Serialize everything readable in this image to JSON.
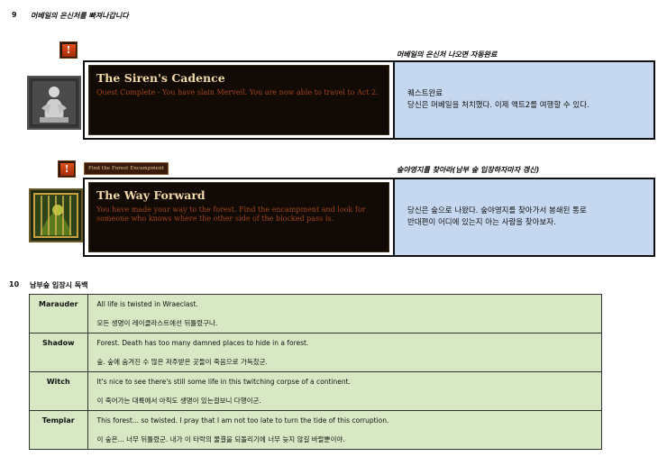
{
  "step9": {
    "number": "9",
    "title": "머베일의 은신처를 빠져나갑니다",
    "quest1": {
      "note": "머베일의 은신처 나오면 자동완료",
      "icon": "siren-statue-icon",
      "name": "The Siren's Cadence",
      "description": "Quest Complete - You have slain Merveil. You are now able to travel to Act 2.",
      "translation_lines": [
        "퀘스트완료",
        "당신은 머베일을 처치했다. 이제 액트2를 여행할 수 있다."
      ]
    },
    "quest2": {
      "banner": "Find the Forest Encampment",
      "note": "숲야영지를 찾아라(남부 숲 입장하자마자 갱신)",
      "icon": "caged-forest-icon",
      "name": "The Way Forward",
      "description": "You have made your way to the forest. Find the encampment and look for someone who knows where the other side of the blocked pass is.",
      "translation_lines": [
        "당신은 숲으로 나왔다. 숲야영지를 찾아가서 봉쇄된 통로",
        "반대편이 어디에 있는지 아는 사람을 찾아보자."
      ]
    }
  },
  "step10": {
    "number": "10",
    "title": "남부숲 입장시 독백",
    "rows": [
      {
        "class_name": "Marauder",
        "en": "All life is twisted in Wraeclast.",
        "ko": "모든 생명이 레이클라스트에선 뒤틀렸구나."
      },
      {
        "class_name": "Shadow",
        "en": "Forest. Death has too many damned places to hide in a forest.",
        "ko": "숲. 숲에 숨겨진 수 많은 저주받은 곳들이 죽음으로 가득찼군."
      },
      {
        "class_name": "Witch",
        "en": "It's nice to see there's still some life in this twitching corpse of a continent.",
        "ko": "이 죽어가는 대륙에서 아직도 생명이 있는걸보니 다행이군."
      },
      {
        "class_name": "Templar",
        "en": "This forest... so twisted. I pray that I am not too late to turn the tide of this corruption.",
        "ko": "이 숲은... 너무 뒤틀렸군. 내가 이 타락의 물결을 되돌리기에 너무 늦지 않길 바랄뿐이야."
      }
    ]
  },
  "colors": {
    "translation_bg": "#c6d8f0",
    "table_bg": "#d8e8c4",
    "quest_bg": "#120a05",
    "quest_title": "#f0d8a8",
    "quest_text": "#a0441c"
  }
}
